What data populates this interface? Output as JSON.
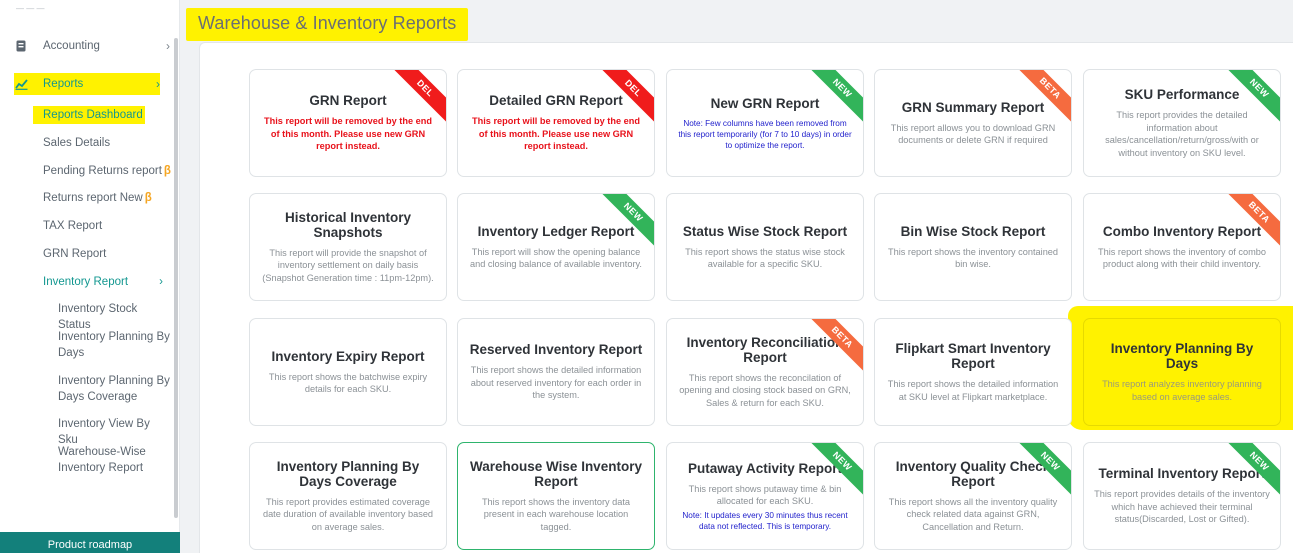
{
  "sidebar": {
    "items": [
      {
        "label": "Accounting"
      },
      {
        "label": "Reports"
      }
    ],
    "sub": [
      {
        "label": "Reports Dashboard"
      },
      {
        "label": "Sales Details"
      },
      {
        "label": "Pending Returns report",
        "beta": "β"
      },
      {
        "label": "Returns report New",
        "beta": "β"
      },
      {
        "label": "TAX Report"
      },
      {
        "label": "GRN Report"
      },
      {
        "label": "Inventory Report"
      }
    ],
    "subsub": [
      {
        "label": "Inventory Stock Status"
      },
      {
        "label": "Inventory Planning By Days"
      },
      {
        "label": "Inventory Planning By Days Coverage"
      },
      {
        "label": "Inventory View By Sku"
      },
      {
        "label": "Warehouse-Wise Inventory Report"
      }
    ],
    "footer": "Product roadmap",
    "accent": "#139790"
  },
  "page": {
    "title": "Warehouse & Inventory Reports"
  },
  "cards": [
    {
      "title": "GRN Report",
      "desc": "This report will be removed by the end of this month. Please use new GRN report instead.",
      "badge": "DEL"
    },
    {
      "title": "Detailed GRN Report",
      "desc": "This report will be removed by the end of this month. Please use new GRN report instead.",
      "badge": "DEL"
    },
    {
      "title": "New GRN Report",
      "desc": "Note: Few columns have been removed from this report temporarily (for 7 to 10 days) in order to optimize the report.",
      "badge": "NEW"
    },
    {
      "title": "GRN Summary Report",
      "desc": "This report allows you to download GRN documents or delete GRN if required",
      "badge": "BETA"
    },
    {
      "title": "SKU Performance",
      "desc": "This report provides the detailed information about sales/cancellation/return/gross/with or without inventory on SKU level.",
      "badge": "NEW"
    },
    {
      "title": "Historical Inventory Snapshots",
      "desc": "This report will provide the snapshot of inventory settlement on daily basis (Snapshot Generation time : 11pm-12pm).",
      "badge": ""
    },
    {
      "title": "Inventory Ledger Report",
      "desc": "This report will show the opening balance and closing balance of available inventory.",
      "badge": "NEW"
    },
    {
      "title": "Status Wise Stock Report",
      "desc": "This report shows the status wise stock available for a specific SKU.",
      "badge": ""
    },
    {
      "title": "Bin Wise Stock Report",
      "desc": "This report shows the inventory contained bin wise.",
      "badge": ""
    },
    {
      "title": "Combo Inventory Report",
      "desc": "This report shows the inventory of combo product along with their child inventory.",
      "badge": "BETA"
    },
    {
      "title": "Inventory Expiry Report",
      "desc": "This report shows the batchwise expiry details for each SKU.",
      "badge": ""
    },
    {
      "title": "Reserved Inventory Report",
      "desc": "This report shows the detailed information about reserved inventory for each order in the system.",
      "badge": ""
    },
    {
      "title": "Inventory Reconciliation Report",
      "desc": "This report shows the reconcilation of opening and closing stock based on GRN, Sales & return for each SKU.",
      "badge": "BETA"
    },
    {
      "title": "Flipkart Smart Inventory Report",
      "desc": "This report shows the detailed information at SKU level at Flipkart marketplace.",
      "badge": ""
    },
    {
      "title": "Inventory Planning By Days",
      "desc": "This report analyzes inventory planning based on average sales.",
      "badge": ""
    },
    {
      "title": "Inventory Planning By Days Coverage",
      "desc": "This report provides estimated coverage date duration of available inventory based on average sales.",
      "badge": ""
    },
    {
      "title": "Warehouse Wise Inventory Report",
      "desc": "This report shows the inventory data present in each warehouse location tagged.",
      "badge": ""
    },
    {
      "title": "Putaway Activity Report",
      "desc": "This report shows putaway time & bin allocated for each SKU.",
      "note": "Note: It updates every 30 minutes thus recent data not reflected. This is temporary.",
      "badge": "NEW"
    },
    {
      "title": "Inventory Quality Check Report",
      "desc": "This report shows all the inventory quality check related data against GRN, Cancellation and Return.",
      "badge": "NEW"
    },
    {
      "title": "Terminal Inventory Report",
      "desc": "This report provides details of the inventory which have achieved their terminal status(Discarded, Lost or Gifted).",
      "badge": "NEW"
    }
  ],
  "colors": {
    "del": "#f01c1c",
    "new": "#32b45a",
    "beta": "#f56b3f",
    "highlight": "#fff200"
  }
}
